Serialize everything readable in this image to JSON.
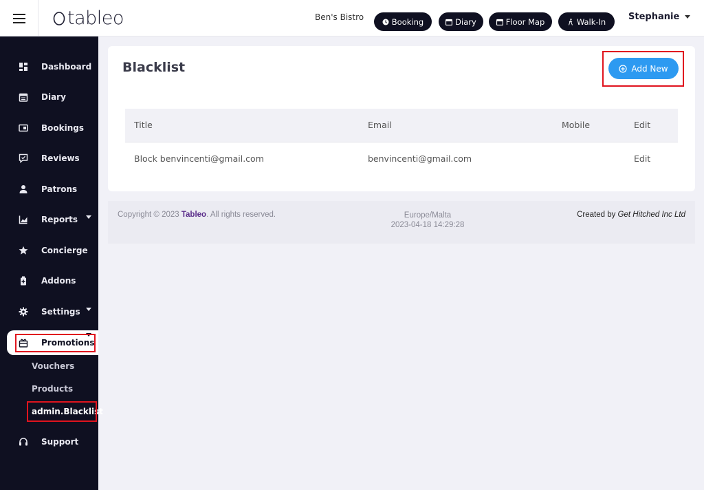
{
  "header": {
    "logo_text": "tableo",
    "venue": "Ben's Bistro",
    "buttons": [
      {
        "label": "Booking",
        "icon": "clock-icon"
      },
      {
        "label": "Diary",
        "icon": "calendar-icon"
      },
      {
        "label": "Floor Map",
        "icon": "map-icon"
      },
      {
        "label": "Walk-In",
        "icon": "walk-icon"
      }
    ],
    "user": "Stephanie"
  },
  "sidebar": {
    "items": [
      {
        "label": "Dashboard",
        "icon": "dashboard-icon"
      },
      {
        "label": "Diary",
        "icon": "calendar-icon"
      },
      {
        "label": "Bookings",
        "icon": "bookings-icon"
      },
      {
        "label": "Reviews",
        "icon": "reviews-icon"
      },
      {
        "label": "Patrons",
        "icon": "person-icon"
      },
      {
        "label": "Reports",
        "icon": "chart-icon"
      },
      {
        "label": "Concierge",
        "icon": "star-icon"
      },
      {
        "label": "Addons",
        "icon": "addons-icon"
      },
      {
        "label": "Settings",
        "icon": "gear-icon"
      },
      {
        "label": "Promotions",
        "icon": "gift-icon"
      },
      {
        "label": "Support",
        "icon": "headset-icon"
      }
    ],
    "sub_items": [
      "Vouchers",
      "Products",
      "admin.Blacklist"
    ]
  },
  "main": {
    "title": "Blacklist",
    "add_button": "Add New",
    "columns": [
      "Title",
      "Email",
      "Mobile",
      "Edit"
    ],
    "rows": [
      {
        "title": "Block benvincenti@gmail.com",
        "email": "benvincenti@gmail.com",
        "mobile": "",
        "edit": "Edit"
      }
    ]
  },
  "footer": {
    "copyright_prefix": "Copyright © 2023 ",
    "brand": "Tableo",
    "copyright_suffix": ". All rights reserved.",
    "timezone": "Europe/Malta",
    "datetime": "2023-04-18 14:29:28",
    "created_prefix": "Created by ",
    "company": "Get Hitched Inc Ltd"
  },
  "colors": {
    "sidebar_bg": "#0f1021",
    "accent_blue": "#2d9af1",
    "highlight_red": "#e0141e",
    "brand_purple": "#5a2d8a"
  }
}
